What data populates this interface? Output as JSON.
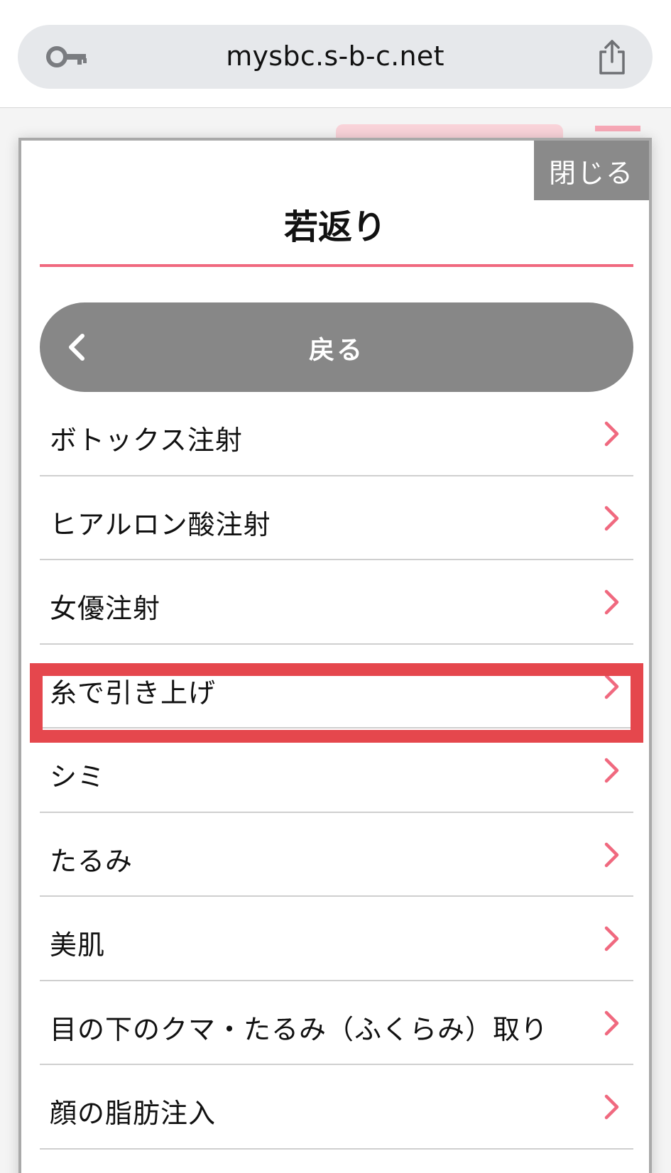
{
  "browser": {
    "url": "mysbc.s-b-c.net",
    "key_icon": "key-icon",
    "share_icon": "share-icon"
  },
  "modal": {
    "close_label": "閉じる",
    "title": "若返り",
    "accent_color": "#f0697f",
    "back_label": "戻る",
    "items": [
      {
        "label": "ボトックス注射"
      },
      {
        "label": "ヒアルロン酸注射"
      },
      {
        "label": "女優注射"
      },
      {
        "label": "糸で引き上げ"
      },
      {
        "label": "シミ"
      },
      {
        "label": "たるみ"
      },
      {
        "label": "美肌"
      },
      {
        "label": "目の下のクマ・たるみ（ふくらみ）取り"
      },
      {
        "label": "顔の脂肪注入"
      }
    ],
    "highlighted_item": "糸で引き上げ",
    "highlight_color": "#e5474d"
  }
}
